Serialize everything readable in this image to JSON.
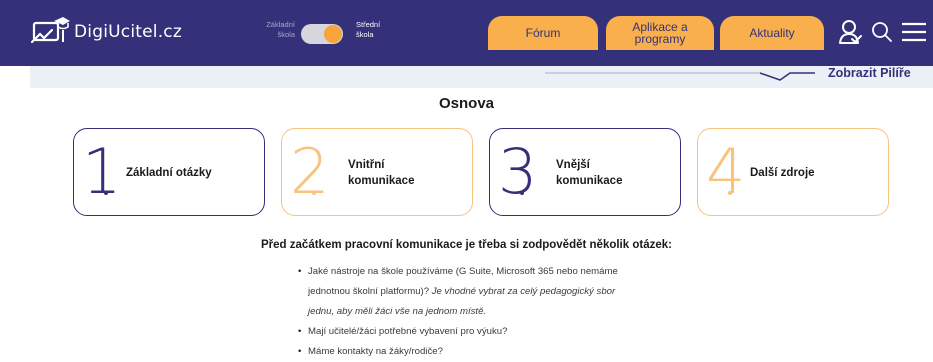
{
  "colors": {
    "brand_navy": "#34307a",
    "accent_orange": "#f9b04c",
    "card_orange_border": "#f7c37e"
  },
  "header": {
    "logo_text": "DigiUcitel.cz",
    "toggle": {
      "left_label_1": "Základní",
      "left_label_2": "škola",
      "right_label_1": "Střední",
      "right_label_2": "škola",
      "state": "on"
    },
    "tabs": [
      {
        "label": "Fórum"
      },
      {
        "label_1": "Aplikace a",
        "label_2": "programy"
      },
      {
        "label": "Aktuality"
      }
    ],
    "icons": [
      "user-icon",
      "search-icon",
      "menu-icon"
    ]
  },
  "subbar": {
    "link_text": "Zobrazit Pilíře"
  },
  "main": {
    "title": "Osnova",
    "cards": [
      {
        "number": "1",
        "label_1": "Základní otázky",
        "label_2": ""
      },
      {
        "number": "2",
        "label_1": "Vnitřní",
        "label_2": "komunikace"
      },
      {
        "number": "3",
        "label_1": "Vnější",
        "label_2": "komunikace"
      },
      {
        "number": "4",
        "label_1": "Další zdroje",
        "label_2": ""
      }
    ],
    "intro": "Před začátkem pracovní komunikace je třeba si zodpovědět několik otázek:",
    "bullets": [
      {
        "line1": "Jaké nástroje na škole používáme (G Suite, Microsoft 365 nebo nemáme",
        "line2_plain": "jednotnou školní platformu)? ",
        "line2_italic": "Je vhodné vybrat za celý pedagogický sbor",
        "line3_italic": "jednu, aby měli žáci vše na jednom místě."
      },
      {
        "line1": "Mají učitelé/žáci potřebné vybavení pro výuku?"
      },
      {
        "line1": "Máme kontakty na žáky/rodiče?"
      }
    ]
  }
}
